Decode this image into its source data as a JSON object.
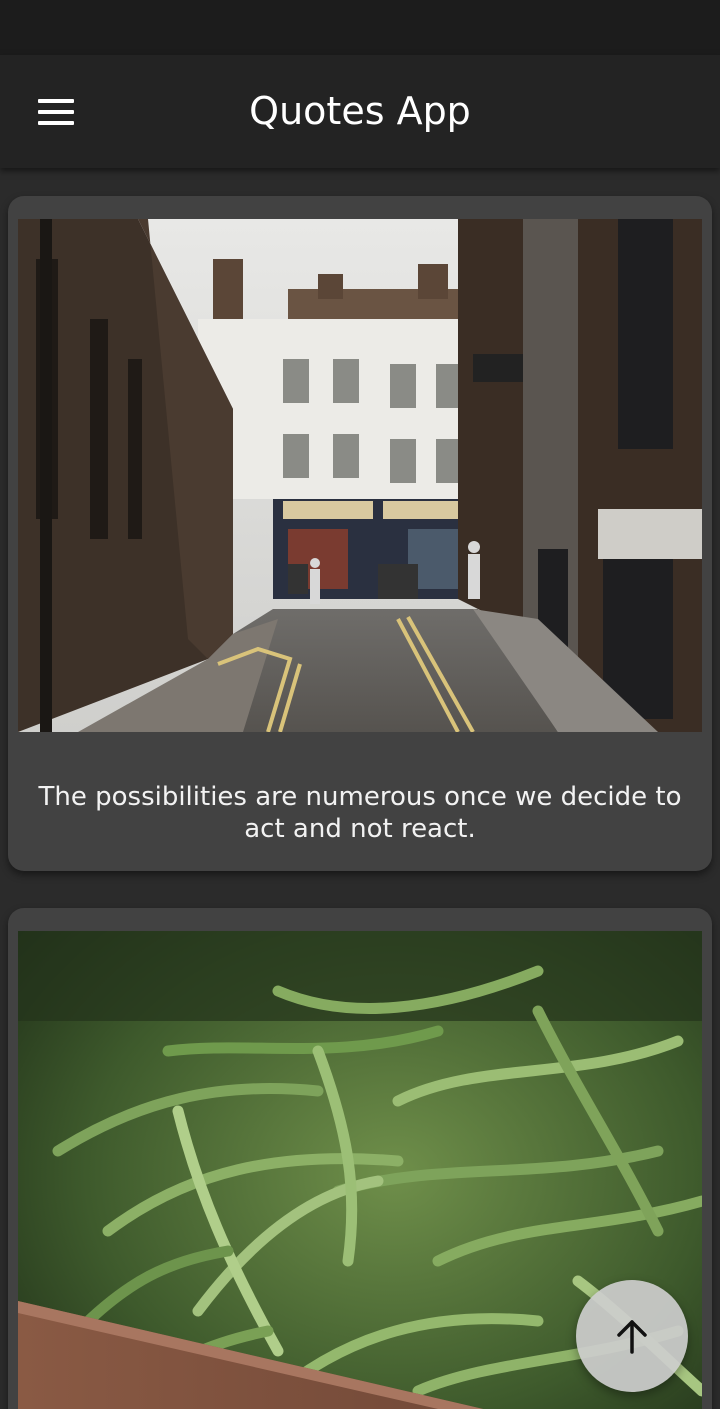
{
  "app_bar": {
    "title": "Quotes App",
    "menu_icon": "hamburger-menu-icon"
  },
  "cards": [
    {
      "image": "street-scene-photo",
      "quote": "The possibilities are numerous once we decide to act and not react."
    },
    {
      "image": "green-beans-photo"
    }
  ],
  "fab": {
    "icon": "arrow-up-icon"
  },
  "colors": {
    "background": "#2b2b2b",
    "app_bar": "#232323",
    "card": "#424242",
    "text": "#ffffff",
    "fab": "#cdcdcd"
  }
}
